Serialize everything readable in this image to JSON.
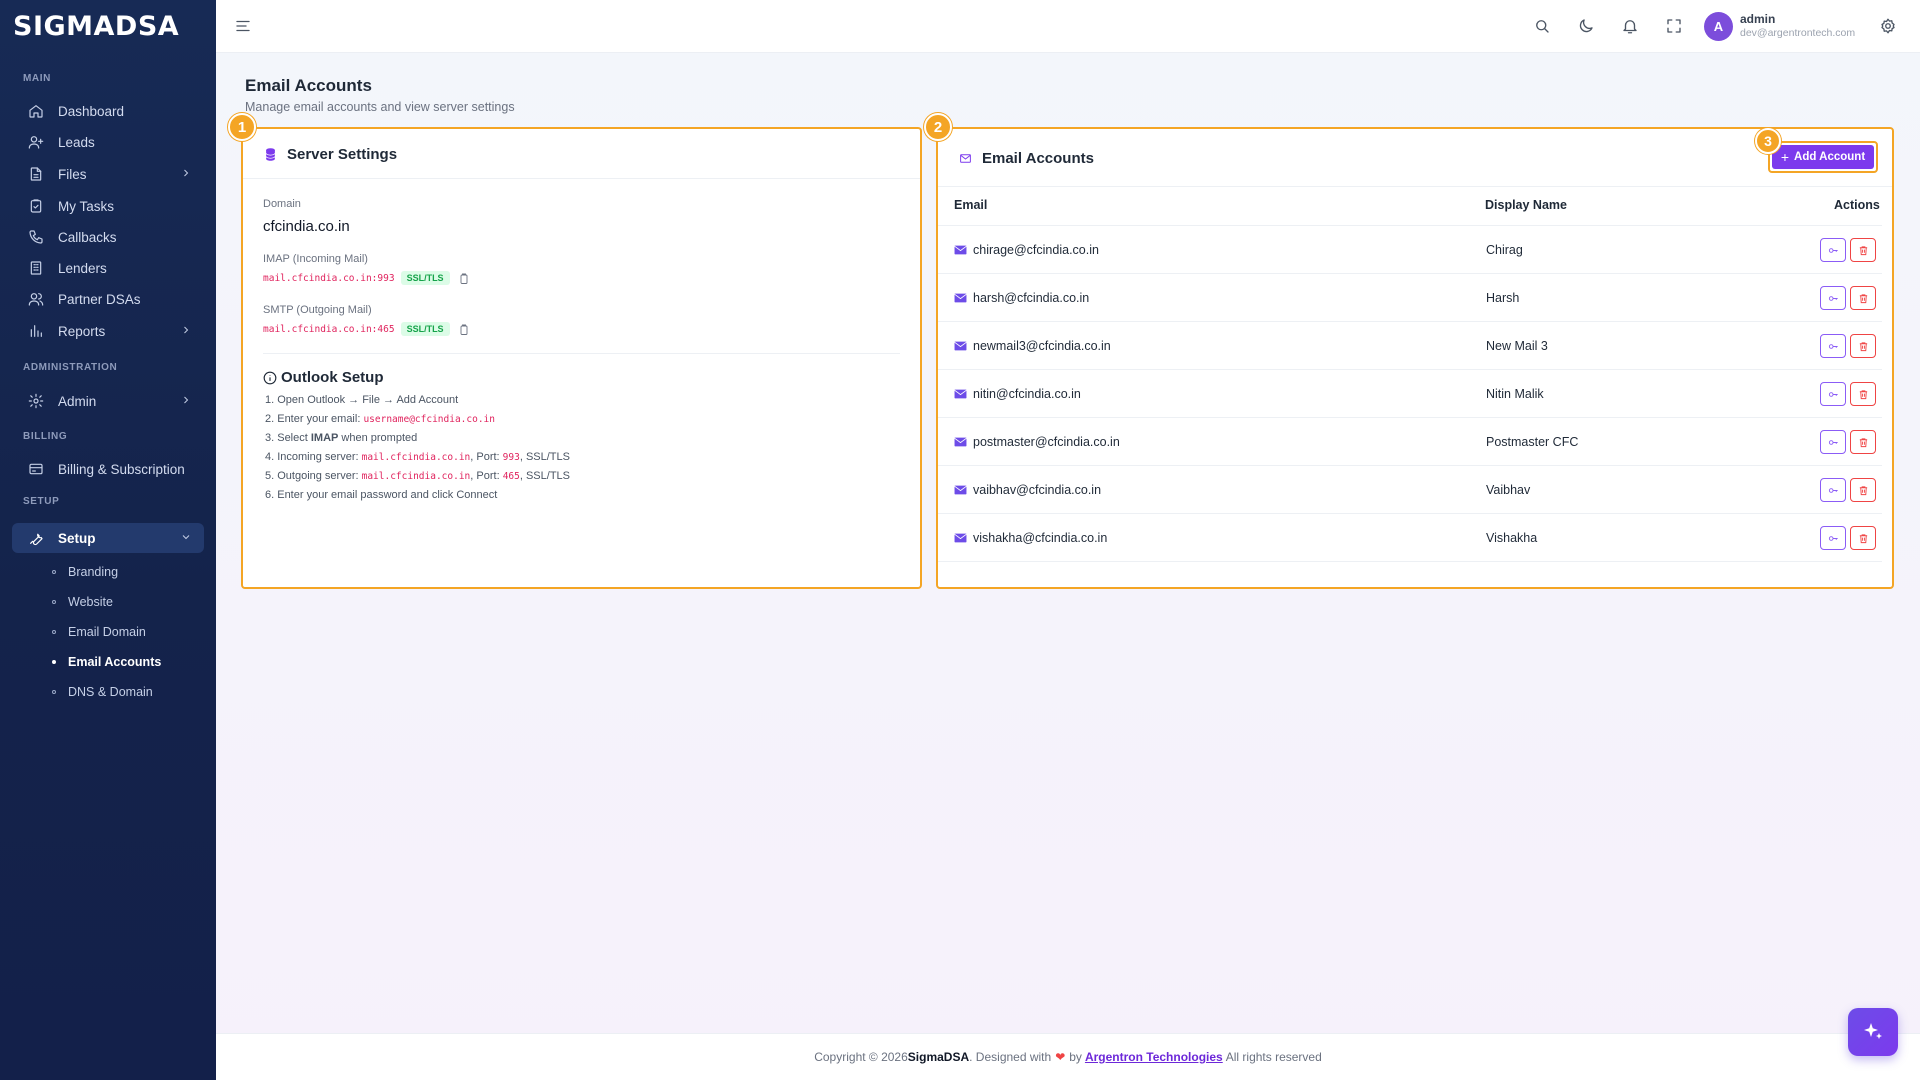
{
  "brand": "SIGMADSA",
  "sidebar": {
    "sections": {
      "main": "MAIN",
      "administration": "ADMINISTRATION",
      "billing": "BILLING",
      "setup": "SETUP"
    },
    "items": {
      "dashboard": "Dashboard",
      "leads": "Leads",
      "files": "Files",
      "my_tasks": "My Tasks",
      "callbacks": "Callbacks",
      "lenders": "Lenders",
      "partner_dsas": "Partner DSAs",
      "reports": "Reports",
      "admin": "Admin",
      "billing_subscription": "Billing & Subscription",
      "setup": "Setup"
    },
    "setup_sub": [
      "Branding",
      "Website",
      "Email Domain",
      "Email Accounts",
      "DNS & Domain"
    ],
    "active_sub": "Email Accounts"
  },
  "topbar": {
    "user_name": "admin",
    "user_email": "dev@argentrontech.com",
    "avatar_letter": "A"
  },
  "page": {
    "title": "Email Accounts",
    "subtitle": "Manage email accounts and view server settings"
  },
  "server_settings": {
    "badge": "1",
    "title": "Server Settings",
    "domain_label": "Domain",
    "domain": "cfcindia.co.in",
    "imap_label": "IMAP (Incoming Mail)",
    "imap_value": "mail.cfcindia.co.in:993",
    "imap_security": "SSL/TLS",
    "smtp_label": "SMTP (Outgoing Mail)",
    "smtp_value": "mail.cfcindia.co.in:465",
    "smtp_security": "SSL/TLS",
    "outlook_title": "Outlook Setup",
    "steps": {
      "s1": "1. Open Outlook → File → Add Account",
      "s2_prefix": "2. Enter your email: ",
      "s2_code": "username@cfcindia.co.in",
      "s3_prefix": "3. Select ",
      "s3_bold": "IMAP",
      "s3_suffix": " when prompted",
      "s4_prefix": "4. Incoming server: ",
      "s4_code": "mail.cfcindia.co.in",
      "s4_mid": ", Port: ",
      "s4_port": "993",
      "s4_suffix": ", SSL/TLS",
      "s5_prefix": "5. Outgoing server: ",
      "s5_code": "mail.cfcindia.co.in",
      "s5_mid": ", Port: ",
      "s5_port": "465",
      "s5_suffix": ", SSL/TLS",
      "s6": "6. Enter your email password and click Connect"
    }
  },
  "email_accounts": {
    "badge": "2",
    "title": "Email Accounts",
    "add_badge": "3",
    "add_label": "Add Account",
    "columns": [
      "Email",
      "Display Name",
      "Actions"
    ],
    "rows": [
      {
        "email": "chirage@cfcindia.co.in",
        "name": "Chirag"
      },
      {
        "email": "harsh@cfcindia.co.in",
        "name": "Harsh"
      },
      {
        "email": "newmail3@cfcindia.co.in",
        "name": "New Mail 3"
      },
      {
        "email": "nitin@cfcindia.co.in",
        "name": "Nitin Malik"
      },
      {
        "email": "postmaster@cfcindia.co.in",
        "name": "Postmaster CFC"
      },
      {
        "email": "vaibhav@cfcindia.co.in",
        "name": "Vaibhav"
      },
      {
        "email": "vishakha@cfcindia.co.in",
        "name": "Vishakha"
      }
    ]
  },
  "footer": {
    "prefix": "Copyright © 2026 ",
    "brand": "SigmaDSA",
    "mid": ". Designed with",
    "by": "by",
    "link": "Argentron Technologies",
    "suffix": "All rights reserved"
  },
  "icons": {
    "brand_accent": "#7c3aed",
    "highlight": "#f4a525"
  }
}
